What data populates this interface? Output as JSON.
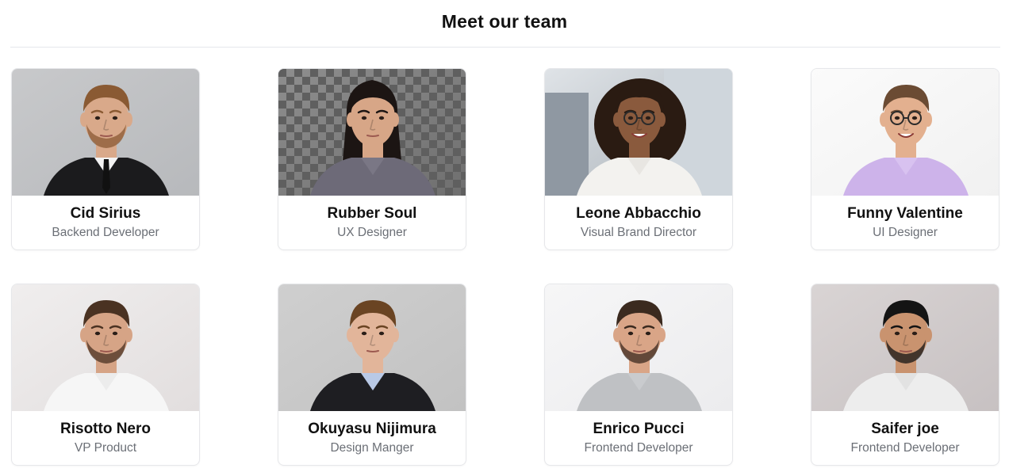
{
  "header": {
    "title": "Meet our team"
  },
  "team": [
    {
      "name": "Cid Sirius",
      "role": "Backend Developer",
      "photo": "portrait-man-beard-suit",
      "colors": {
        "bg": "#c8c9cb",
        "bg2": "#b7b9bc",
        "skin": "#d9a98a",
        "hair": "#8a5a33",
        "shirt": "#1b1b1d",
        "collar": "#f3f3f3"
      }
    },
    {
      "name": "Rubber Soul",
      "role": "UX Designer",
      "photo": "portrait-woman-long-dark-hair",
      "colors": {
        "bg": "#8e8e8e",
        "bg2": "#6f6f6f",
        "skin": "#d7a687",
        "hair": "#1c1513",
        "shirt": "#6d6a78",
        "collar": "#7a7785"
      }
    },
    {
      "name": "Leone Abbacchio",
      "role": "Visual Brand Director",
      "photo": "portrait-woman-curly-hair-glasses",
      "colors": {
        "bg": "#dfe3e7",
        "bg2": "#a9b1b8",
        "skin": "#8a5a3d",
        "hair": "#2a1b12",
        "shirt": "#f3f2ef",
        "collar": "#e8e6e2"
      }
    },
    {
      "name": "Funny Valentine",
      "role": "UI Designer",
      "photo": "portrait-man-smiling-glasses",
      "colors": {
        "bg": "#fbfbfb",
        "bg2": "#f1f1f1",
        "skin": "#e3b08f",
        "hair": "#6b4b33",
        "shirt": "#cdb3ea",
        "collar": "#d8c2f0"
      }
    },
    {
      "name": "Risotto Nero",
      "role": "VP Product",
      "photo": "portrait-man-short-hair",
      "colors": {
        "bg": "#f0eeee",
        "bg2": "#e2dede",
        "skin": "#d6a486",
        "hair": "#4a3222",
        "shirt": "#f6f6f6",
        "collar": "#ececec"
      }
    },
    {
      "name": "Okuyasu Nijimura",
      "role": "Design Manger",
      "photo": "portrait-young-man-blazer",
      "colors": {
        "bg": "#cfcfcf",
        "bg2": "#c2c2c2",
        "skin": "#e2b59a",
        "hair": "#6a4423",
        "shirt": "#1e1e22",
        "collar": "#b9c9e6"
      }
    },
    {
      "name": "Enrico Pucci",
      "role": "Frontend Developer",
      "photo": "portrait-man-crew-neck",
      "colors": {
        "bg": "#f6f6f7",
        "bg2": "#ececee",
        "skin": "#d9a587",
        "hair": "#3b2a1f",
        "shirt": "#bfc1c4",
        "collar": "#c9cbce"
      }
    },
    {
      "name": "Saifer joe",
      "role": "Frontend Developer",
      "photo": "portrait-man-beard-tshirt",
      "colors": {
        "bg": "#d9d4d4",
        "bg2": "#c7c1c2",
        "skin": "#c9936f",
        "hair": "#141414",
        "shirt": "#ededed",
        "collar": "#e2e2e2"
      }
    }
  ]
}
